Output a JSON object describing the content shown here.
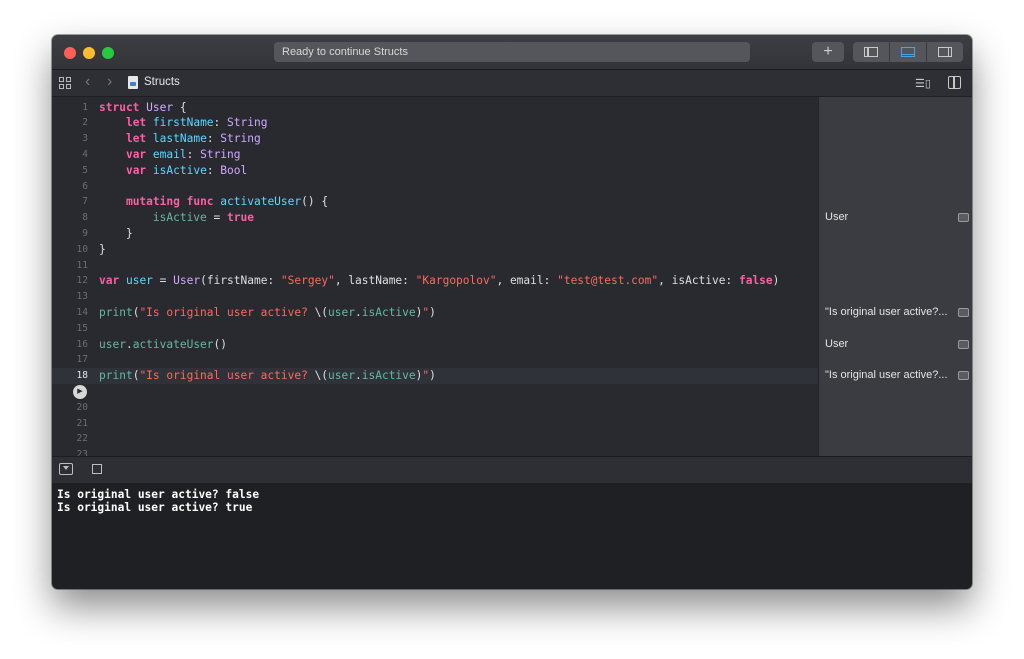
{
  "window": {
    "status_text": "Ready to continue Structs",
    "add_label": "+"
  },
  "jumpbar": {
    "file_name": "Structs",
    "back_arrow": "‹",
    "forward_arrow": "›",
    "editor_options_glyph": "☰▯"
  },
  "editor": {
    "current_line": 18,
    "run_marker_line": 19,
    "run_marker_glyph": "▶",
    "lines": [
      {
        "n": "1",
        "html": "<span class=\"kw\">struct</span> <span class=\"ty\">User</span> {"
      },
      {
        "n": "2",
        "html": "    <span class=\"kw\">let</span> <span class=\"pr\">firstName</span>: <span class=\"ty\">String</span>"
      },
      {
        "n": "3",
        "html": "    <span class=\"kw\">let</span> <span class=\"pr\">lastName</span>: <span class=\"ty\">String</span>"
      },
      {
        "n": "4",
        "html": "    <span class=\"kw\">var</span> <span class=\"pr\">email</span>: <span class=\"ty\">String</span>"
      },
      {
        "n": "5",
        "html": "    <span class=\"kw\">var</span> <span class=\"pr\">isActive</span>: <span class=\"ty\">Bool</span>"
      },
      {
        "n": "6",
        "html": ""
      },
      {
        "n": "7",
        "html": "    <span class=\"kw\">mutating</span> <span class=\"kw\">func</span> <span class=\"pr\">activateUser</span>() {"
      },
      {
        "n": "8",
        "html": "        <span class=\"fn\">isActive</span> = <span class=\"kw\">true</span>"
      },
      {
        "n": "9",
        "html": "    }"
      },
      {
        "n": "10",
        "html": "}"
      },
      {
        "n": "11",
        "html": ""
      },
      {
        "n": "12",
        "html": "<span class=\"kw\">var</span> <span class=\"pr\">user</span> = <span class=\"ty\">User</span>(firstName: <span class=\"st\">\"Sergey\"</span>, lastName: <span class=\"st\">\"Kargopolov\"</span>, email: <span class=\"st\">\"test@test.com\"</span>, isActive: <span class=\"kw\">false</span>)"
      },
      {
        "n": "13",
        "html": ""
      },
      {
        "n": "14",
        "html": "<span class=\"fn\">print</span>(<span class=\"st\">\"Is original user active? </span>\\(<span class=\"fn\">user</span>.<span class=\"fn\">isActive</span>)<span class=\"st\">\"</span>)"
      },
      {
        "n": "15",
        "html": ""
      },
      {
        "n": "16",
        "html": "<span class=\"fn\">user</span>.<span class=\"fn\">activateUser</span>()"
      },
      {
        "n": "17",
        "html": ""
      },
      {
        "n": "18",
        "html": "<span class=\"fn\">print</span>(<span class=\"st\">\"Is original user active? </span>\\(<span class=\"fn\">user</span>.<span class=\"fn\">isActive</span>)<span class=\"st\">\"</span>)"
      },
      {
        "n": "",
        "html": ""
      },
      {
        "n": "20",
        "html": ""
      },
      {
        "n": "21",
        "html": ""
      },
      {
        "n": "22",
        "html": ""
      },
      {
        "n": "23",
        "html": ""
      }
    ]
  },
  "results": [
    {
      "line": 8,
      "text": "User"
    },
    {
      "line": 14,
      "text": "\"Is original user active?..."
    },
    {
      "line": 16,
      "text": "User"
    },
    {
      "line": 18,
      "text": "\"Is original user active?..."
    }
  ],
  "console": {
    "lines": [
      "Is original user active? false",
      "Is original user active? true"
    ]
  },
  "colors": {
    "keyword": "#fc5fa3",
    "type": "#d0a8ff",
    "property": "#5dd8ff",
    "string": "#fc6a5d",
    "function": "#67b7a4",
    "background": "#292a30",
    "accent": "#4aa3e6"
  },
  "icons": {
    "navigator_toggle": "sidebar-left-icon",
    "debug_toggle": "panel-bottom-icon",
    "inspector_toggle": "sidebar-right-icon",
    "grid": "grid-icon",
    "file": "swift-file-icon",
    "hide_debug": "hide-debug-area-icon",
    "stop": "stop-icon",
    "result_toggle": "show-result-icon"
  }
}
